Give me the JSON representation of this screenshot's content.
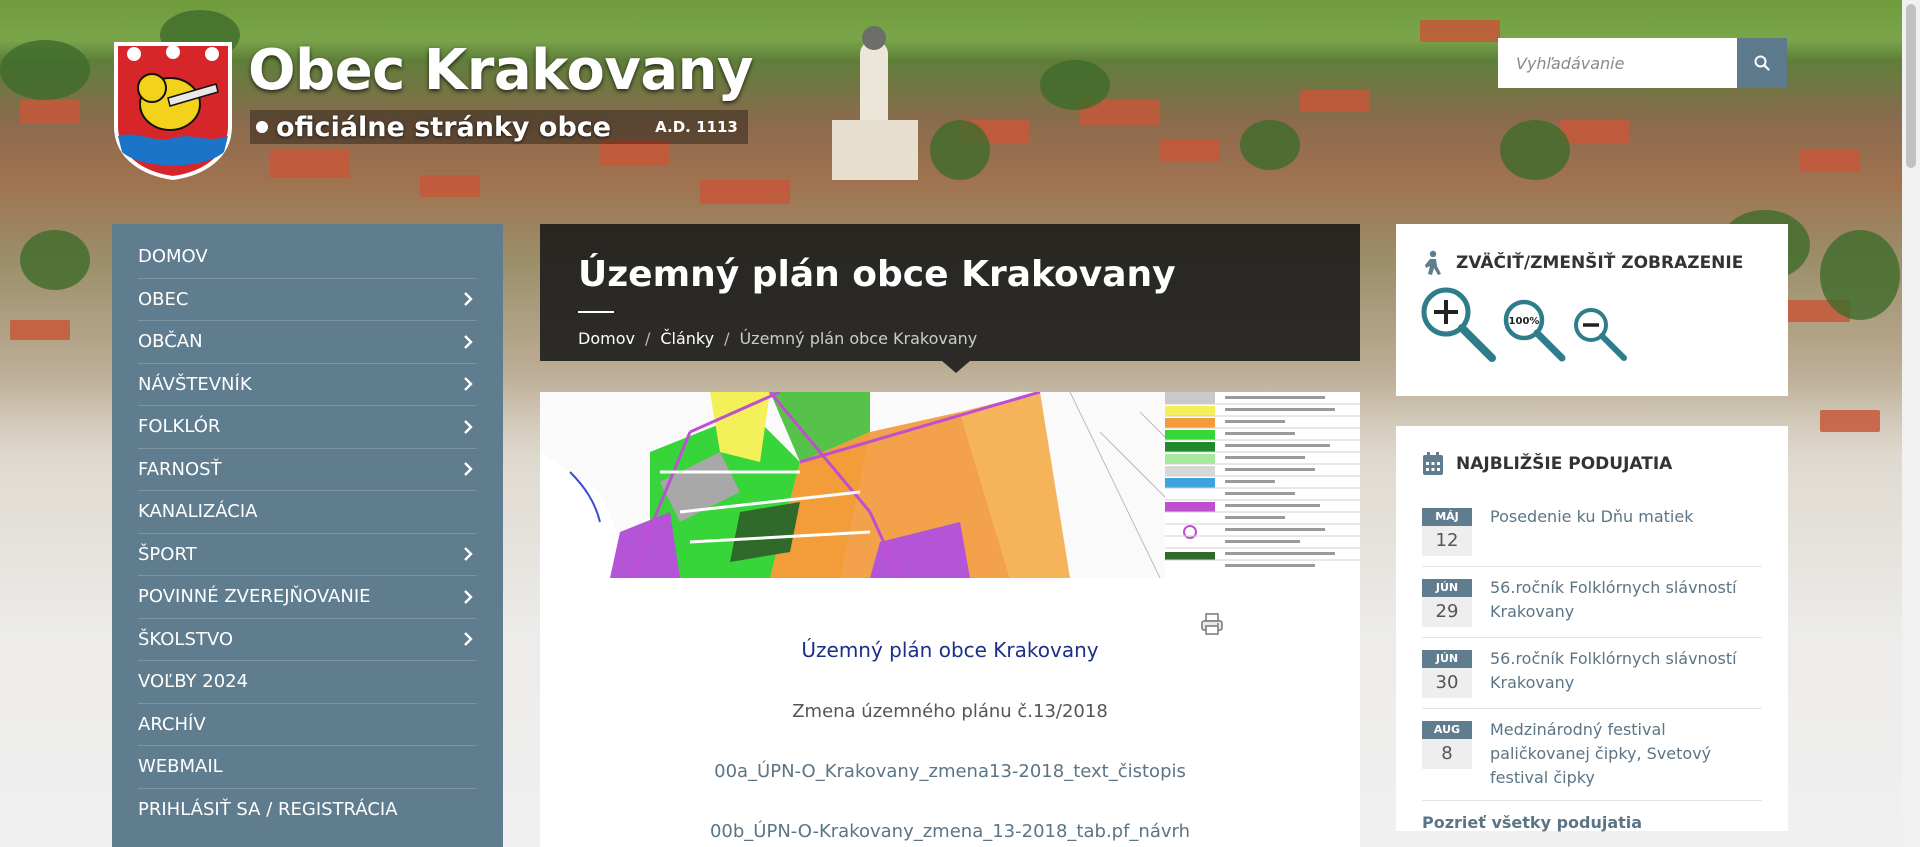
{
  "site": {
    "title": "Obec Krakovany",
    "subtitle": "oficiálne stránky obce",
    "year": "A.D. 1113"
  },
  "search": {
    "placeholder": "Vyhľadávanie",
    "icon": "search-icon"
  },
  "nav": [
    {
      "label": "Domov",
      "has_submenu": false
    },
    {
      "label": "Obec",
      "has_submenu": true
    },
    {
      "label": "Občan",
      "has_submenu": true
    },
    {
      "label": "Návštevník",
      "has_submenu": true
    },
    {
      "label": "Folklór",
      "has_submenu": true
    },
    {
      "label": "Farnosť",
      "has_submenu": true
    },
    {
      "label": "Kanalizácia",
      "has_submenu": false
    },
    {
      "label": "Šport",
      "has_submenu": true
    },
    {
      "label": "Povinné zverejňovanie",
      "has_submenu": true
    },
    {
      "label": "Školstvo",
      "has_submenu": true
    },
    {
      "label": "Voľby 2024",
      "has_submenu": false
    },
    {
      "label": "Archív",
      "has_submenu": false
    },
    {
      "label": "Webmail",
      "has_submenu": false
    },
    {
      "label": "Prihlásiť sa / Registrácia",
      "has_submenu": false
    }
  ],
  "page": {
    "title": "Územný plán obce Krakovany",
    "breadcrumb": [
      "Domov",
      "Články",
      "Územný plán obce Krakovany"
    ]
  },
  "content": {
    "heading": "Územný plán obce Krakovany",
    "subheading": "Zmena územného plánu č.13/2018",
    "links": [
      "00a_ÚPN-O_Krakovany_zmena13-2018_text_čistopis",
      "00b_ÚPN-O-Krakovany_zmena_13-2018_tab.pf_návrh"
    ]
  },
  "zoom_widget": {
    "title": "Zväčiť/Zmenšiť zobrazenie",
    "zoom_reset_label": "100%"
  },
  "events_widget": {
    "title": "Najbližšie podujatia",
    "events": [
      {
        "month": "MÁJ",
        "day": "12",
        "title": "Posedenie ku Dňu matiek"
      },
      {
        "month": "JÚN",
        "day": "29",
        "title": "56.ročník Folklórnych slávností Krakovany"
      },
      {
        "month": "JÚN",
        "day": "30",
        "title": "56.ročník Folklórnych slávností Krakovany"
      },
      {
        "month": "AUG",
        "day": "8",
        "title": "Medzinárodný festival paličkovanej čipky, Svetový festival čipky"
      }
    ],
    "all_link": "Pozrieť všetky podujatia"
  },
  "colors": {
    "sidebar": "#5f7d8e",
    "link": "#5b7586",
    "zoom_icon": "#2f7d8a"
  }
}
